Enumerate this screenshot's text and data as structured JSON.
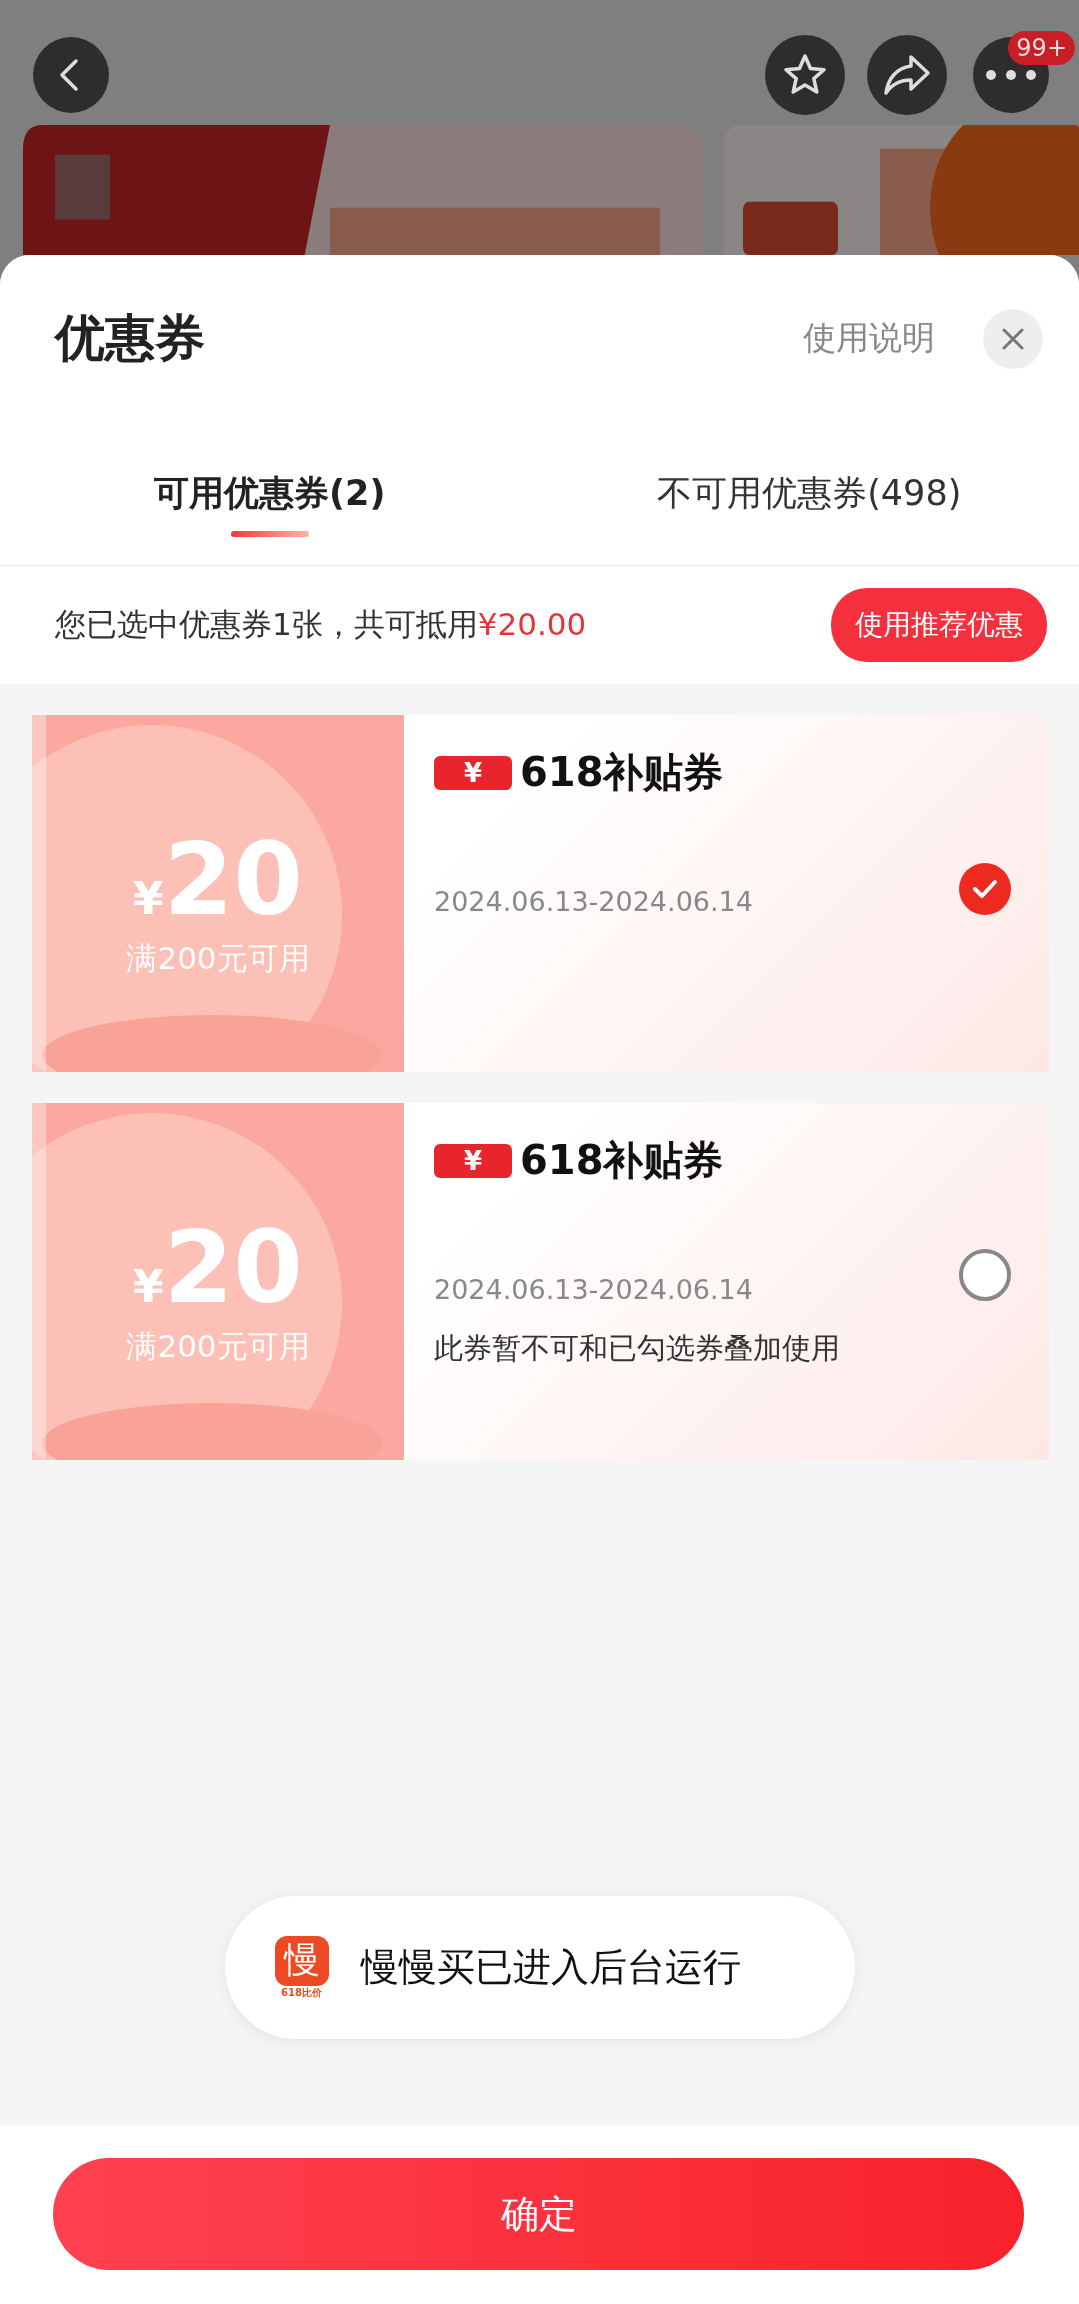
{
  "top_bar": {
    "badge": "99+"
  },
  "sheet": {
    "title": "优惠券",
    "help_link": "使用说明",
    "tabs": [
      {
        "label": "可用优惠券(2)",
        "selected": true
      },
      {
        "label": "不可用优惠券(498)",
        "selected": false
      }
    ],
    "summary": {
      "text": "您已选中优惠券1张，共可抵用",
      "amount": "¥20.00",
      "button": "使用推荐优惠"
    },
    "coupons": [
      {
        "currency": "¥",
        "value": "20",
        "condition": "满200元可用",
        "tag_icon": "¥",
        "name": "618补贴券",
        "dates": "2024.06.13-2024.06.14",
        "checked": true
      },
      {
        "currency": "¥",
        "value": "20",
        "condition": "满200元可用",
        "tag_icon": "¥",
        "name": "618补贴券",
        "dates": "2024.06.13-2024.06.14",
        "note": "此券暂不可和已勾选券叠加使用",
        "checked": false
      }
    ],
    "confirm": "确定"
  },
  "toast": {
    "icon_char": "慢",
    "icon_caption": "618比价",
    "text": "慢慢买已进入后台运行"
  }
}
